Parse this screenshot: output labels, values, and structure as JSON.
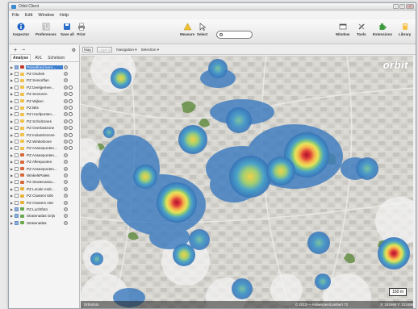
{
  "window": {
    "title": "Orbit Client"
  },
  "menu": [
    "File",
    "Edit",
    "Window",
    "Help"
  ],
  "toolbar": {
    "inspector": "Inspector",
    "preferences": "Preferences",
    "save_all": "Save all",
    "print": "Print",
    "measure": "Measure",
    "select": "Select",
    "window": "Window",
    "tools": "Tools",
    "extensions": "Extensions",
    "library": "Library"
  },
  "panel": {
    "add": "+",
    "remove": "−",
    "tabs": [
      "Analyse",
      "AVL",
      "Scheloon"
    ],
    "layers": [
      {
        "label": "Preselfond kern...",
        "color": "#c0392b"
      },
      {
        "label": "PZ Ondrek",
        "color": "#f0c24b"
      },
      {
        "label": "PZ Seniorflan",
        "color": "#f0c24b"
      },
      {
        "label": "PZ Deelgemee...",
        "color": "#f0c24b"
      },
      {
        "label": "PZ Sectoren",
        "color": "#f0c24b"
      },
      {
        "label": "PZ Wijken",
        "color": "#f0c24b"
      },
      {
        "label": "PZ Bks",
        "color": "#f0c24b"
      },
      {
        "label": "PZ Hoofpunten...",
        "color": "#f0c24b"
      },
      {
        "label": "PZ Scholzones",
        "color": "#f0c24b"
      },
      {
        "label": "PZ Overlastzone",
        "color": "#f0c24b"
      },
      {
        "label": "PZ Industriezone",
        "color": "#f0c24b"
      },
      {
        "label": "PZ Winkelzone",
        "color": "#f0c24b"
      },
      {
        "label": "PZ Anseepunten...",
        "color": "#f0c24b"
      },
      {
        "label": "PZ Anseepunten...",
        "color": "#d86a3a"
      },
      {
        "label": "PZ Afleepunten",
        "color": "#d86a3a"
      },
      {
        "label": "PZ Anseepunten...",
        "color": "#d86a3a"
      },
      {
        "label": "WinkelsPaleis",
        "color": "#d86a3a"
      },
      {
        "label": "PZ Stratenassa...",
        "color": "#d86a3a"
      },
      {
        "label": "PZ Locale mob...",
        "color": "#e8b23a"
      },
      {
        "label": "PZ Clusters 500",
        "color": "#e8b23a"
      },
      {
        "label": "PZ Clusters 150",
        "color": "#e8b23a"
      },
      {
        "label": "PZ Luchtfoto",
        "color": "#6aa84f"
      },
      {
        "label": "Stratenatlas Grijs",
        "color": "#6aa84f"
      },
      {
        "label": "Stratenatlas",
        "color": "#6aa84f"
      }
    ]
  },
  "map_toolbar": {
    "map": "Map",
    "legend": "Legend",
    "navigation": "Navigation",
    "selection": "Selection"
  },
  "map": {
    "logo": "orbit",
    "scale": "150 m",
    "status_left": "Orthofoto",
    "status_mid": "© 2013 — Antwerpen/Lambert 72",
    "status_right": "X: 152468 Y: 212458"
  },
  "colors": {
    "selection": "#3d7fd0",
    "heat_low": "#3a7fc1",
    "heat_high": "#d8142c"
  }
}
